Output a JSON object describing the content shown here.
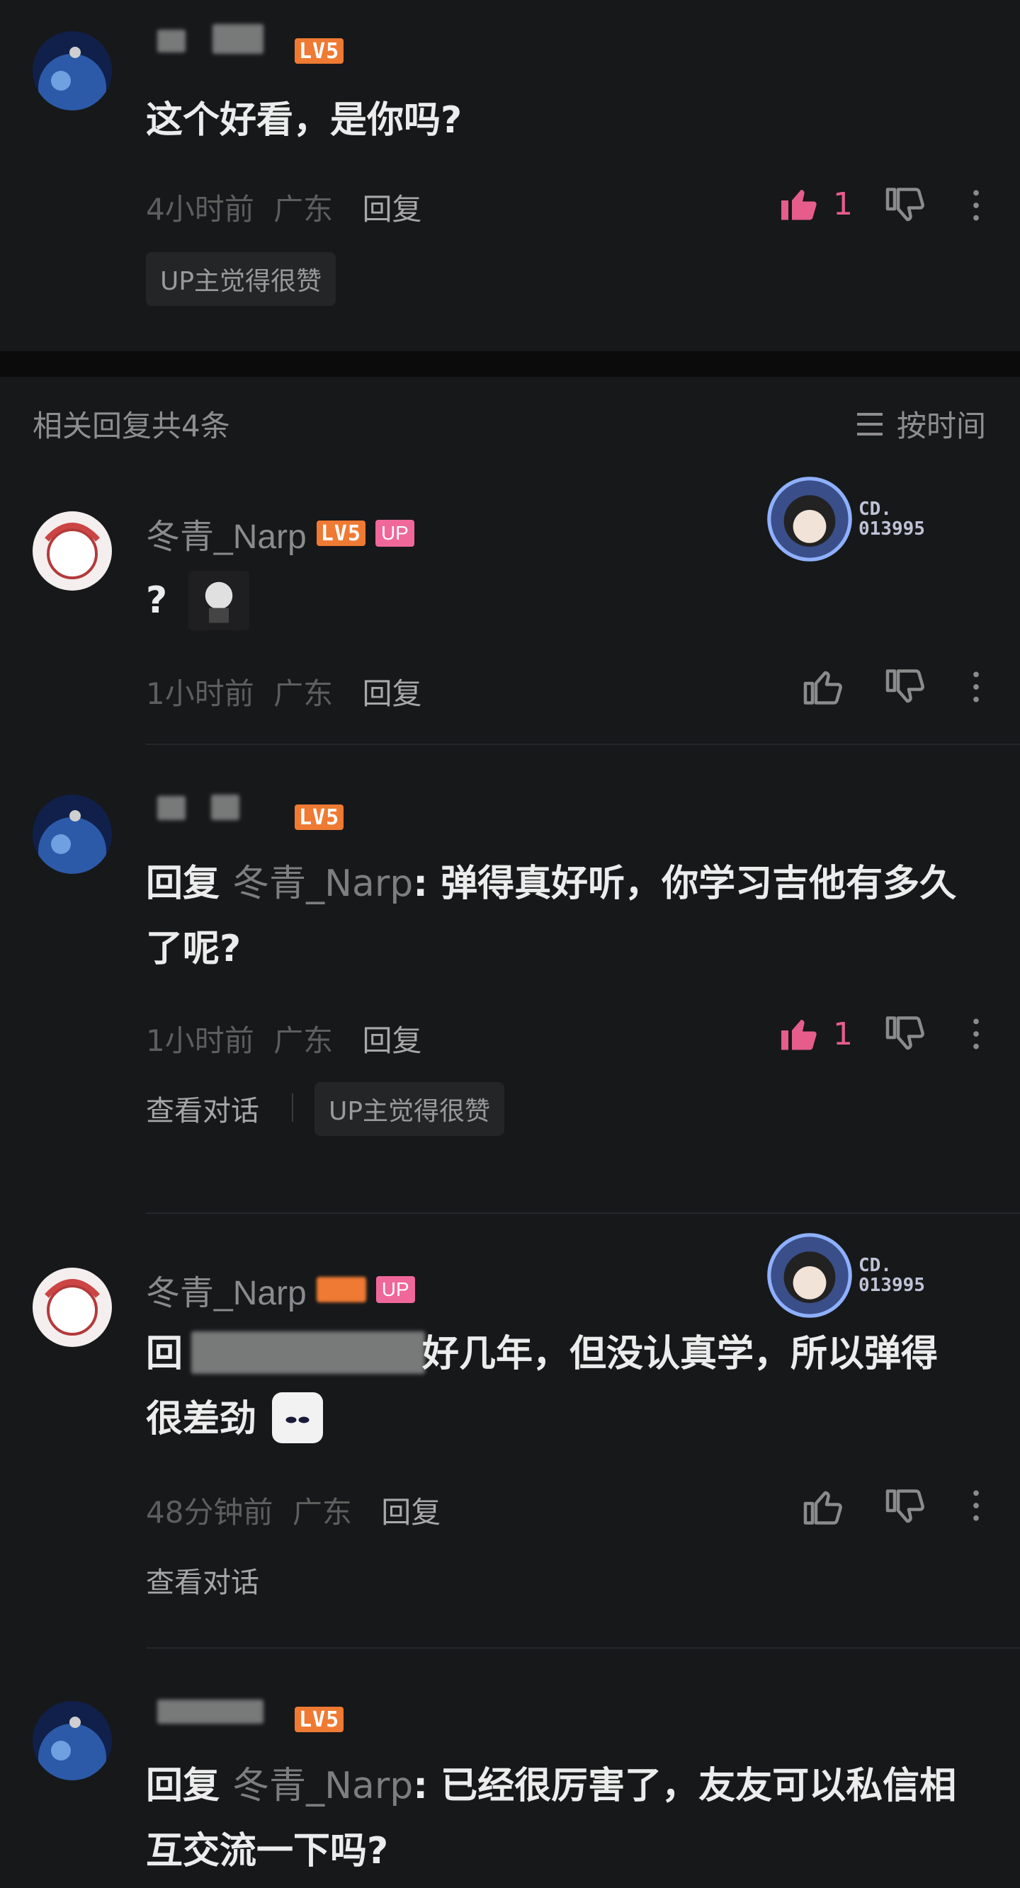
{
  "colors": {
    "bg": "#17181a",
    "accent_pink": "#e65d8c",
    "level_orange": "#ef7a33",
    "up_badge": "#f0679a"
  },
  "top_comment": {
    "level": "LV5",
    "text": "这个好看，是你吗?",
    "time": "4小时前",
    "location": "广东",
    "reply_label": "回复",
    "likes": "1",
    "tag": "UP主觉得很赞"
  },
  "replies_header": {
    "title": "相关回复共4条",
    "sort_label": "按时间"
  },
  "replies": [
    {
      "username": "冬青_Narp",
      "level": "LV5",
      "up_badge": "UP",
      "text": "?",
      "time": "1小时前",
      "location": "广东",
      "reply_label": "回复",
      "fan_badge": [
        "CD.",
        "013995"
      ]
    },
    {
      "level": "LV5",
      "reply_prefix": "回复",
      "mention": "冬青_Narp",
      "text": ": 弹得真好听，你学习吉他有多久了呢?",
      "time": "1小时前",
      "location": "广东",
      "reply_label": "回复",
      "likes": "1",
      "view_conversation": "查看对话",
      "tag": "UP主觉得很赞"
    },
    {
      "username": "冬青_Narp",
      "up_badge": "UP",
      "text_visible_start": "回",
      "text": "好几年，但没认真学，所以弹得很差劲",
      "time": "48分钟前",
      "location": "广东",
      "reply_label": "回复",
      "view_conversation": "查看对话",
      "fan_badge": [
        "CD.",
        "013995"
      ]
    },
    {
      "level": "LV5",
      "reply_prefix": "回复",
      "mention": "冬青_Narp",
      "text": ": 已经很厉害了，友友可以私信相互交流一下吗?"
    }
  ],
  "icons": [
    "thumb-up-icon",
    "thumb-down-icon",
    "more-icon",
    "sort-list-icon"
  ]
}
